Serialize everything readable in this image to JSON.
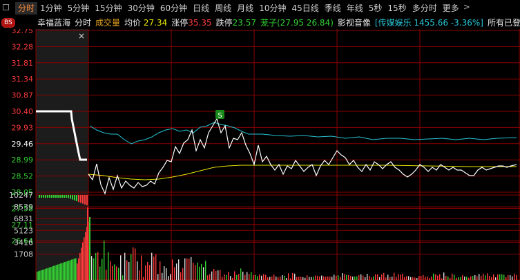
{
  "tabs": [
    "分时",
    "1分钟",
    "5分钟",
    "15分钟",
    "30分钟",
    "60分钟",
    "日线",
    "周线",
    "月线",
    "10分钟",
    "45日线",
    "季线",
    "年线",
    "5秒",
    "15秒",
    "多分时",
    "更多"
  ],
  "active_tab": "分时",
  "more_arrow": ">",
  "bs_badge": "BS",
  "info": {
    "stock_name": "幸福蓝海",
    "mode": "分时",
    "volume_label": "成交量",
    "avg_label": "均价",
    "avg_value": "27.34",
    "limit_up_label": "涨停",
    "limit_up_value": "35.35",
    "limit_down_label": "跌停",
    "limit_down_value": "23.57",
    "range_label": "茏子(27.95 26.84)",
    "sector_label": "影视音像",
    "index_text": "[传媒娱乐 1455.66 -3.36%]",
    "account_label": "所有已登录账户"
  },
  "close_glyph": "×",
  "marker_label": "S",
  "price_axis": [
    "32.75",
    "32.28",
    "31.81",
    "31.34",
    "30.87",
    "30.40",
    "29.93",
    "29.46",
    "28.99",
    "28.52",
    "28.05",
    "27.58",
    "27.11",
    "26.64"
  ],
  "volume_axis": [
    "10247",
    "8539",
    "6831",
    "5123",
    "3416",
    "1708"
  ],
  "colors": {
    "up": "#ff3b3b",
    "down": "#33d033",
    "price_line": "#ffffff",
    "avg_line": "#e8e800",
    "index_line": "#27c3d4",
    "grid": "#8b0000",
    "active_tab": "#ff8c3a"
  }
}
